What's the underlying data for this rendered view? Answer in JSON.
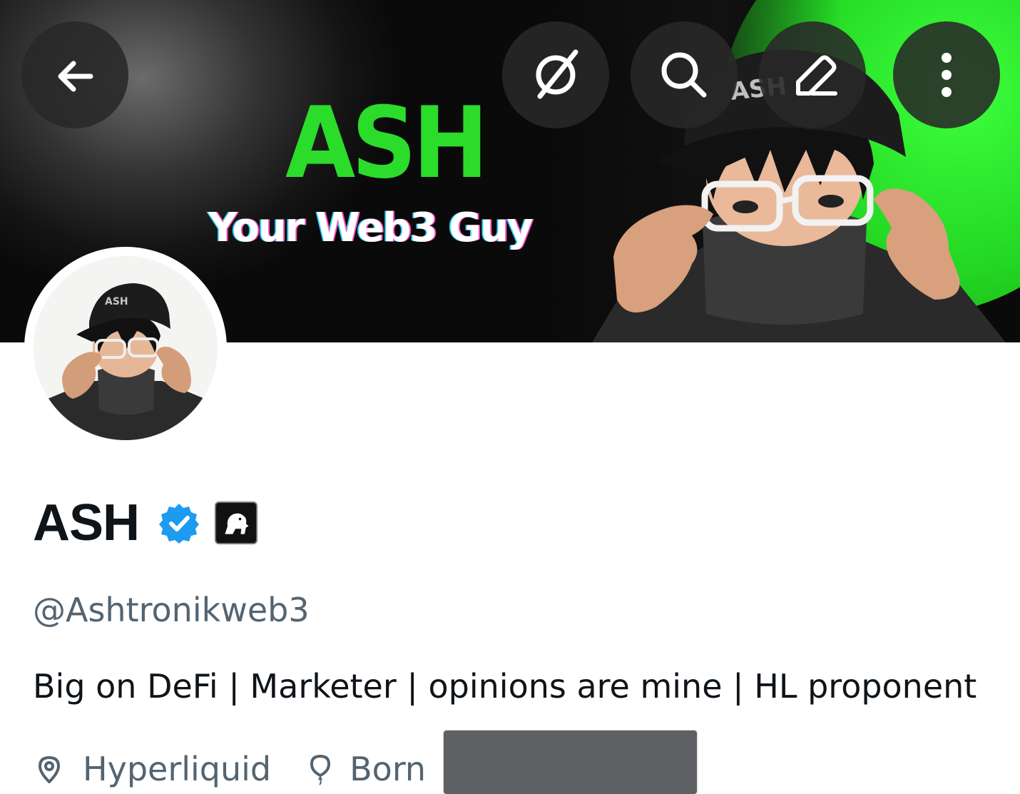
{
  "banner": {
    "title": "ASH",
    "subtitle": "Your Web3 Guy",
    "cap_text": "ASH"
  },
  "toolbar": {
    "back_icon": "arrow-left-icon",
    "grok_icon": "grok-icon",
    "search_icon": "search-icon",
    "edit_icon": "pencil-icon",
    "more_icon": "more-vertical-icon"
  },
  "avatar": {
    "cap_text": "ASH"
  },
  "profile": {
    "display_name": "ASH",
    "verified_icon": "verified-badge-icon",
    "verified_color": "#1d9bf0",
    "affiliate_icon": "lion-icon",
    "handle": "@Ashtronikweb3",
    "bio": "Big on DeFi | Marketer | opinions are mine | HL proponent",
    "location_icon": "location-pin-icon",
    "location": "Hyperliquid",
    "birthday_icon": "balloon-icon",
    "birthday_prefix": "Born"
  },
  "colors": {
    "brand_green": "#2bdc2b",
    "text_primary": "#0f1419",
    "text_secondary": "#536471"
  }
}
